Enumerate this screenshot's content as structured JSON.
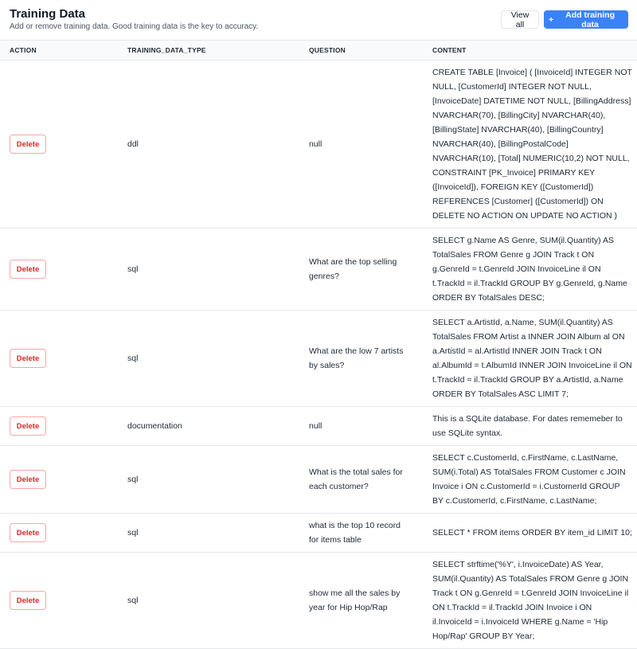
{
  "header": {
    "title": "Training Data",
    "subtitle": "Add or remove training data. Good training data is the key to accuracy.",
    "view_all": "View all",
    "add_label": "Add training data",
    "add_icon": "plus-icon"
  },
  "table": {
    "columns": [
      "ACTION",
      "TRAINING_DATA_TYPE",
      "QUESTION",
      "CONTENT"
    ],
    "delete_label": "Delete",
    "rows": [
      {
        "type": "ddl",
        "question": "null",
        "content": "CREATE TABLE [Invoice] ( [InvoiceId] INTEGER NOT NULL, [CustomerId] INTEGER NOT NULL, [InvoiceDate] DATETIME NOT NULL, [BillingAddress] NVARCHAR(70), [BillingCity] NVARCHAR(40), [BillingState] NVARCHAR(40), [BillingCountry] NVARCHAR(40), [BillingPostalCode] NVARCHAR(10), [Total] NUMERIC(10,2) NOT NULL, CONSTRAINT [PK_Invoice] PRIMARY KEY ([InvoiceId]), FOREIGN KEY ([CustomerId]) REFERENCES [Customer] ([CustomerId]) ON DELETE NO ACTION ON UPDATE NO ACTION )"
      },
      {
        "type": "sql",
        "question": "What are the top selling genres?",
        "content": "SELECT g.Name AS Genre, SUM(il.Quantity) AS TotalSales FROM Genre g JOIN Track t ON g.GenreId = t.GenreId JOIN InvoiceLine il ON t.TrackId = il.TrackId GROUP BY g.GenreId, g.Name ORDER BY TotalSales DESC;"
      },
      {
        "type": "sql",
        "question": "What are the low 7 artists by sales?",
        "content": "SELECT a.ArtistId, a.Name, SUM(il.Quantity) AS TotalSales FROM Artist a INNER JOIN Album al ON a.ArtistId = al.ArtistId INNER JOIN Track t ON al.AlbumId = t.AlbumId INNER JOIN InvoiceLine il ON t.TrackId = il.TrackId GROUP BY a.ArtistId, a.Name ORDER BY TotalSales ASC LIMIT 7;"
      },
      {
        "type": "documentation",
        "question": "null",
        "content": "This is a SQLite database. For dates rememeber to use SQLite syntax."
      },
      {
        "type": "sql",
        "question": "What is the total sales for each customer?",
        "content": "SELECT c.CustomerId, c.FirstName, c.LastName, SUM(i.Total) AS TotalSales FROM Customer c JOIN Invoice i ON c.CustomerId = i.CustomerId GROUP BY c.CustomerId, c.FirstName, c.LastName;"
      },
      {
        "type": "sql",
        "question": "what is the top 10 record for items table",
        "content": "SELECT * FROM items ORDER BY item_id LIMIT 10;"
      },
      {
        "type": "sql",
        "question": "show me all the sales by year for Hip Hop/Rap",
        "content": "SELECT strftime('%Y', i.InvoiceDate) AS Year, SUM(il.Quantity) AS TotalSales FROM Genre g JOIN Track t ON g.GenreId = t.GenreId JOIN InvoiceLine il ON t.TrackId = il.TrackId JOIN Invoice i ON il.InvoiceId = i.InvoiceId WHERE g.Name = 'Hip Hop/Rap' GROUP BY Year;"
      }
    ]
  }
}
